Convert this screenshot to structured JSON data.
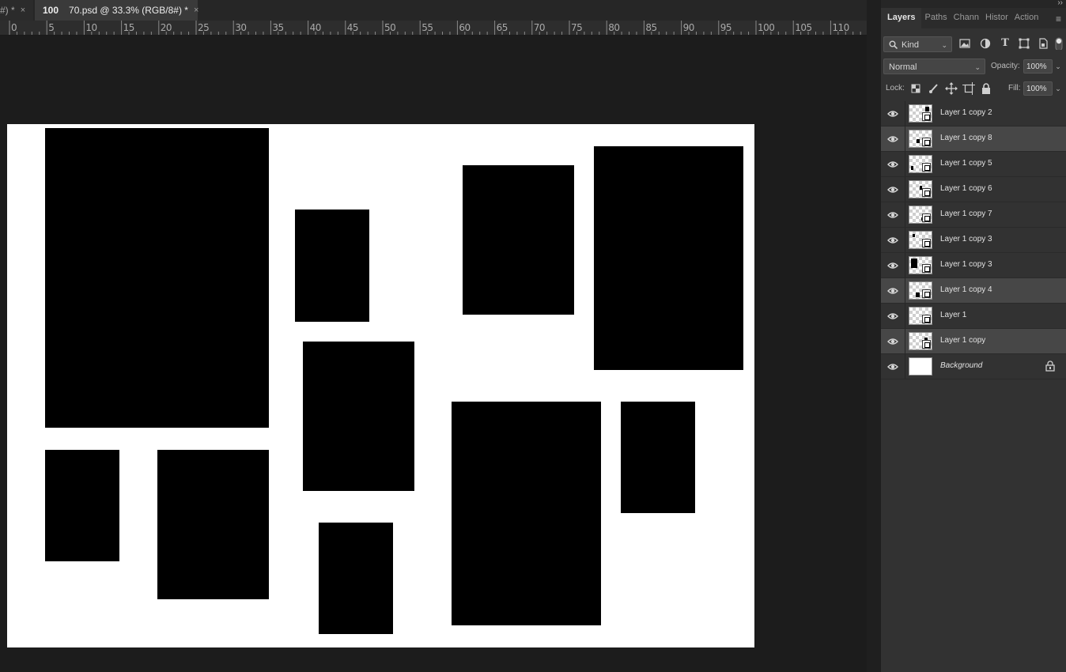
{
  "tabs": [
    {
      "label": "#) *",
      "close": "×"
    },
    {
      "label_bold": "100",
      "label": "70.psd @ 33.3% (RGB/8#) *",
      "close": "×"
    }
  ],
  "ruler": {
    "labels": [
      "0",
      "5",
      "10",
      "15",
      "20",
      "25",
      "30",
      "35",
      "40",
      "45",
      "50",
      "55",
      "60",
      "65",
      "70",
      "75",
      "80",
      "85",
      "90",
      "95",
      "100",
      "105",
      "110"
    ]
  },
  "panel": {
    "collapse_icon": "››",
    "tabs": [
      "Layers",
      "Paths",
      "Chann",
      "Histor",
      "Action"
    ],
    "menu_icon": "≡",
    "filter": {
      "label": "Kind",
      "icon": "search-icon"
    },
    "blend_mode": "Normal",
    "opacity_label": "Opacity:",
    "opacity_value": "100%",
    "lock_label": "Lock:",
    "fill_label": "Fill:",
    "fill_value": "100%",
    "layers": [
      {
        "name": "Layer 1 copy 2",
        "selected": false
      },
      {
        "name": "Layer 1 copy 8",
        "selected": true
      },
      {
        "name": "Layer 1 copy 5",
        "selected": false
      },
      {
        "name": "Layer 1 copy 6",
        "selected": false
      },
      {
        "name": "Layer 1 copy 7",
        "selected": false
      },
      {
        "name": "Layer 1 copy 3",
        "selected": false
      },
      {
        "name": "Layer 1 copy 3",
        "selected": false
      },
      {
        "name": "Layer 1 copy 4",
        "selected": true
      },
      {
        "name": "Layer 1",
        "selected": false
      },
      {
        "name": "Layer 1 copy",
        "selected": true
      },
      {
        "name": "Background",
        "selected": false,
        "locked": true
      }
    ]
  }
}
